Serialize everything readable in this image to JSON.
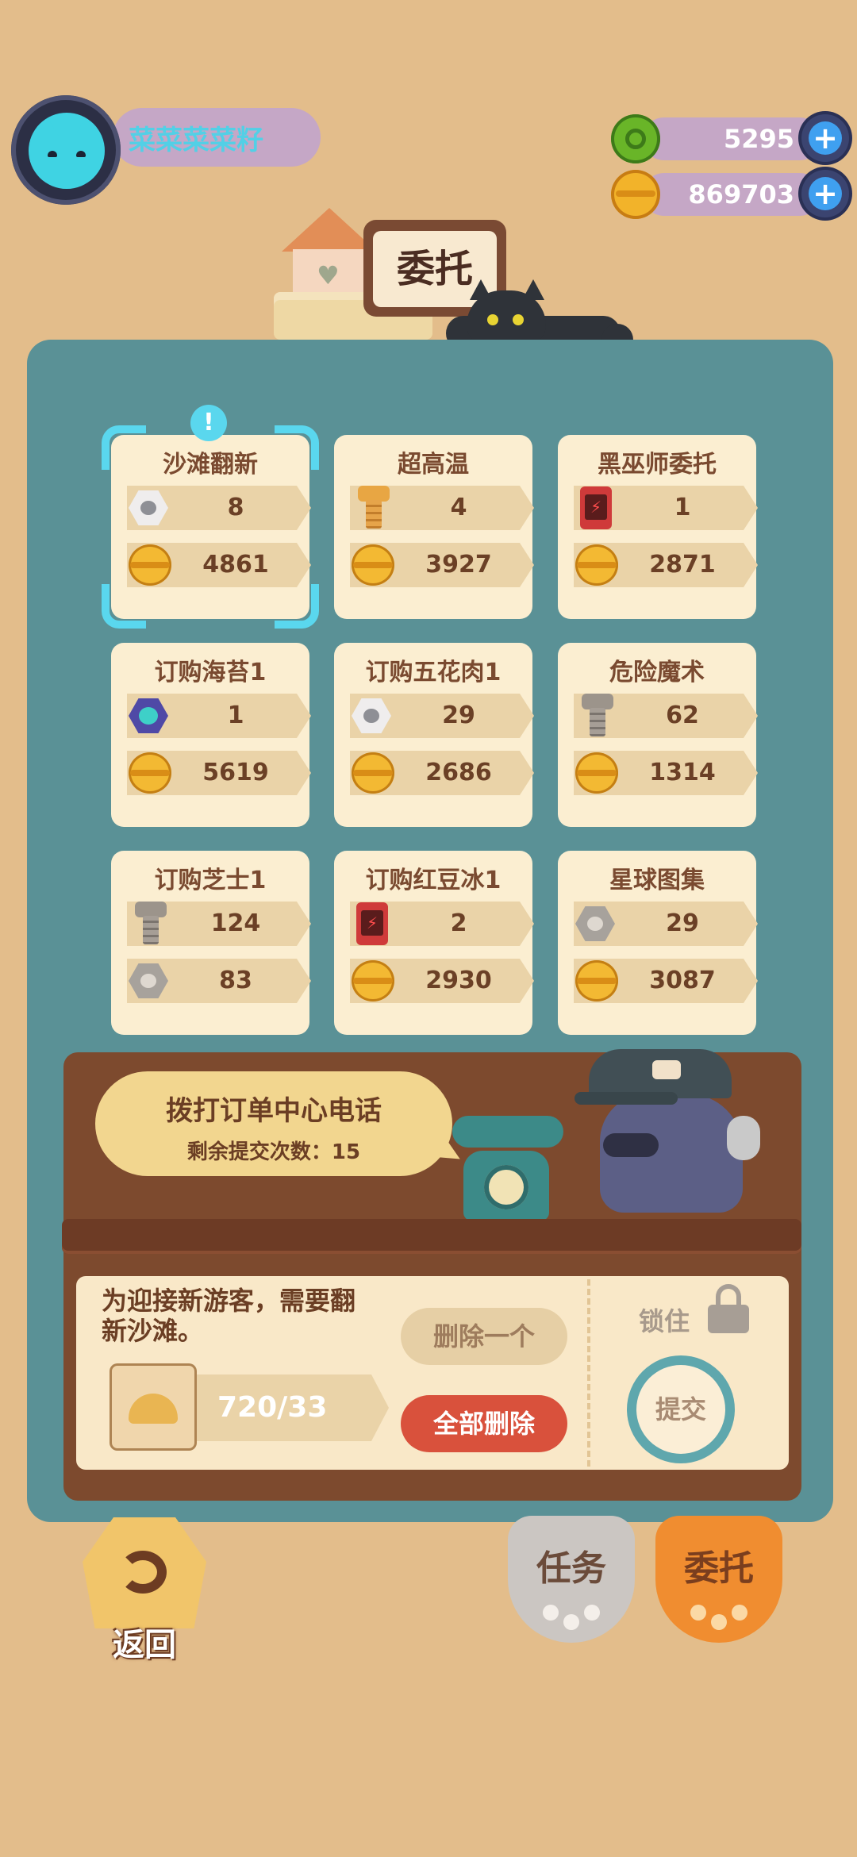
{
  "player": {
    "name": "菜菜菜菜籽"
  },
  "resources": [
    {
      "icon": "green-gem-coin-icon",
      "value": "5295"
    },
    {
      "icon": "gold-coin-icon",
      "value": "869703"
    }
  ],
  "title_sign": "委托",
  "orders": [
    {
      "title": "沙滩翻新",
      "item_icon": "white-nut-icon",
      "item_qty": "8",
      "reward_icon": "gold-coin-icon",
      "reward": "4861",
      "selected": true,
      "alert": "!"
    },
    {
      "title": "超高温",
      "item_icon": "gold-bolt-icon",
      "item_qty": "4",
      "reward_icon": "gold-coin-icon",
      "reward": "3927"
    },
    {
      "title": "黑巫师委托",
      "item_icon": "red-battery-icon",
      "item_qty": "1",
      "reward_icon": "gold-coin-icon",
      "reward": "2871"
    },
    {
      "title": "订购海苔1",
      "item_icon": "purple-nut-icon",
      "item_qty": "1",
      "reward_icon": "gold-coin-icon",
      "reward": "5619"
    },
    {
      "title": "订购五花肉1",
      "item_icon": "white-nut-icon",
      "item_qty": "29",
      "reward_icon": "gold-coin-icon",
      "reward": "2686"
    },
    {
      "title": "危险魔术",
      "item_icon": "gray-bolt-icon",
      "item_qty": "62",
      "reward_icon": "gold-coin-icon",
      "reward": "1314"
    },
    {
      "title": "订购芝士1",
      "item_icon": "gray-bolt-icon",
      "item_qty": "124",
      "reward_icon": "gray-nut-icon",
      "reward": "83"
    },
    {
      "title": "订购红豆冰1",
      "item_icon": "red-battery-icon",
      "item_qty": "2",
      "reward_icon": "gold-coin-icon",
      "reward": "2930"
    },
    {
      "title": "星球图集",
      "item_icon": "gray-nut-icon",
      "item_qty": "29",
      "reward_icon": "gold-coin-icon",
      "reward": "3087"
    }
  ],
  "call_center": {
    "title": "拨打订单中心电话",
    "remaining": "剩余提交次数：15"
  },
  "detail": {
    "description": "为迎接新游客，需要翻新沙滩。",
    "item_icon": "sand-pile-icon",
    "progress_text": "720/33",
    "delete_one": "删除一个",
    "delete_all": "全部删除",
    "lock": "锁住",
    "submit": "提交"
  },
  "bottom": {
    "back": "返回",
    "tasks": "任务",
    "entrust": "委托"
  },
  "colors": {
    "background": "#e3bd8b",
    "panel": "#5a9196",
    "card": "#fbeed1",
    "selection": "#5ad7ee",
    "delete_all": "#d9513c",
    "entrust_tab": "#f08d30"
  }
}
